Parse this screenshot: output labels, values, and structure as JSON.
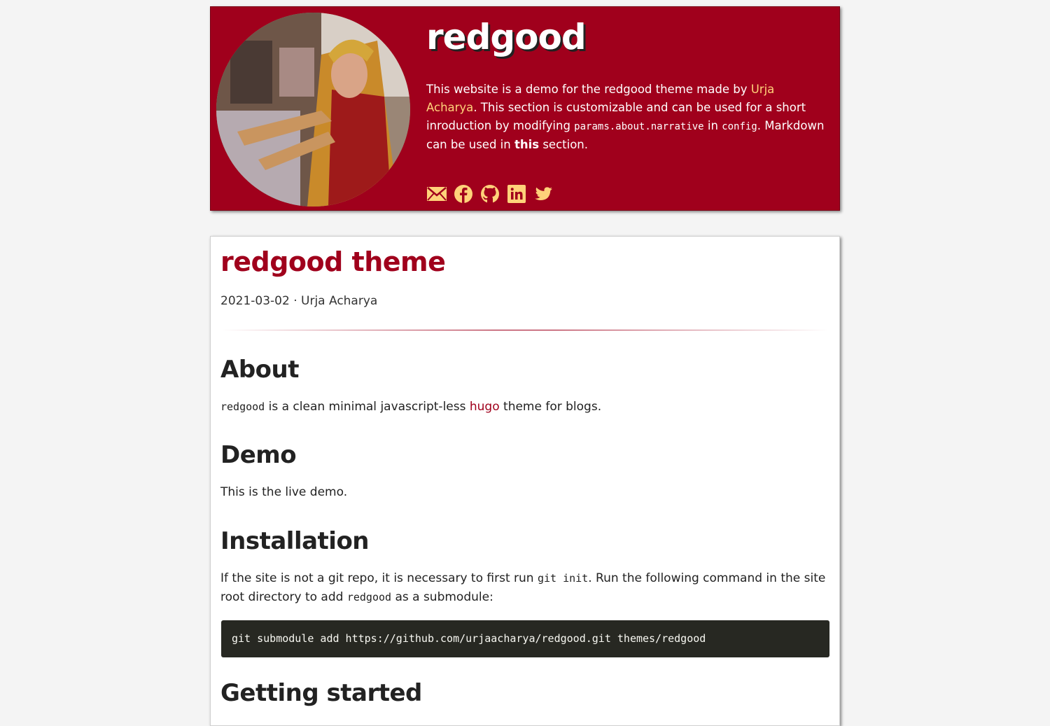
{
  "header": {
    "site_title": "redgood",
    "narrative": {
      "t1": "This website is a demo for the redgood theme made by ",
      "author_link": "Urja Acharya",
      "t2": ". This section is customizable and can be used for a short inroduction by modifying ",
      "code1": "params.about.narrative",
      "t3": " in ",
      "code2": "config",
      "t4": ". Markdown can be used in ",
      "bold": "this",
      "t5": " section."
    },
    "social_icons": [
      "email-icon",
      "facebook-icon",
      "github-icon",
      "linkedin-icon",
      "twitter-icon"
    ],
    "colors": {
      "brand": "#a0001c",
      "link": "#ffd27a"
    }
  },
  "post": {
    "title": "redgood theme",
    "meta": "2021-03-02 · Urja Acharya",
    "about": {
      "heading": "About",
      "code": "redgood",
      "t1": " is a clean minimal javascript-less ",
      "link": "hugo",
      "t2": " theme for blogs."
    },
    "demo": {
      "heading": "Demo",
      "text": "This is the live demo."
    },
    "installation": {
      "heading": "Installation",
      "t1": "If the site is not a git repo, it is necessary to first run ",
      "code1": "git init",
      "t2": ". Run the following command in the site root directory to add ",
      "code2": "redgood",
      "t3": " as a submodule:",
      "command": "git submodule add https://github.com/urjaacharya/redgood.git themes/redgood"
    },
    "getting_started": {
      "heading": "Getting started"
    }
  }
}
